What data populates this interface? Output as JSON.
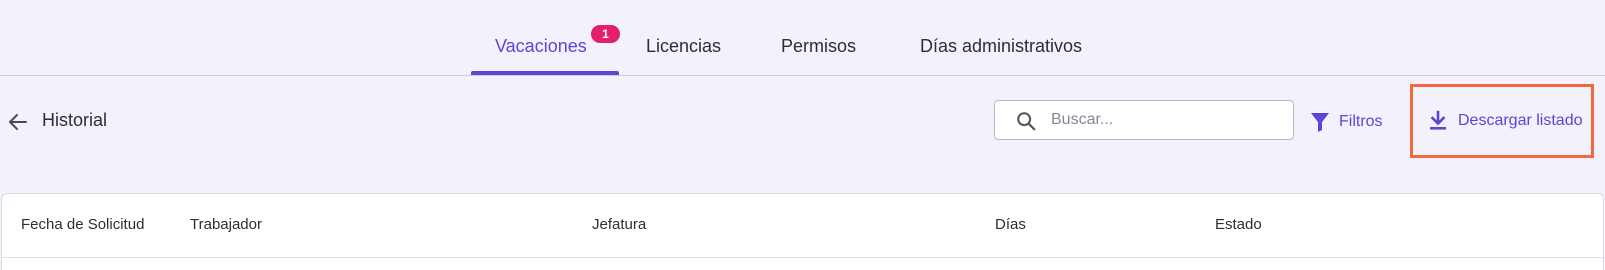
{
  "tabs": {
    "items": [
      {
        "label": "Vacaciones",
        "active": true,
        "badge": "1"
      },
      {
        "label": "Licencias"
      },
      {
        "label": "Permisos"
      },
      {
        "label": "Días administrativos"
      }
    ]
  },
  "header": {
    "title": "Historial",
    "back_icon": "arrow-left-icon"
  },
  "search": {
    "placeholder": "Buscar...",
    "value": "",
    "icon": "search-icon"
  },
  "toolbar": {
    "filters_label": "Filtros",
    "filters_icon": "filter-icon",
    "download_label": "Descargar listado",
    "download_icon": "download-icon"
  },
  "table": {
    "columns": [
      "Fecha de Solicitud",
      "Trabajador",
      "Jefatura",
      "Días",
      "Estado"
    ]
  },
  "colors": {
    "accent": "#5b46d6",
    "badge": "#e0206a",
    "highlight": "#f26a3c",
    "background": "#f3f1fc"
  }
}
